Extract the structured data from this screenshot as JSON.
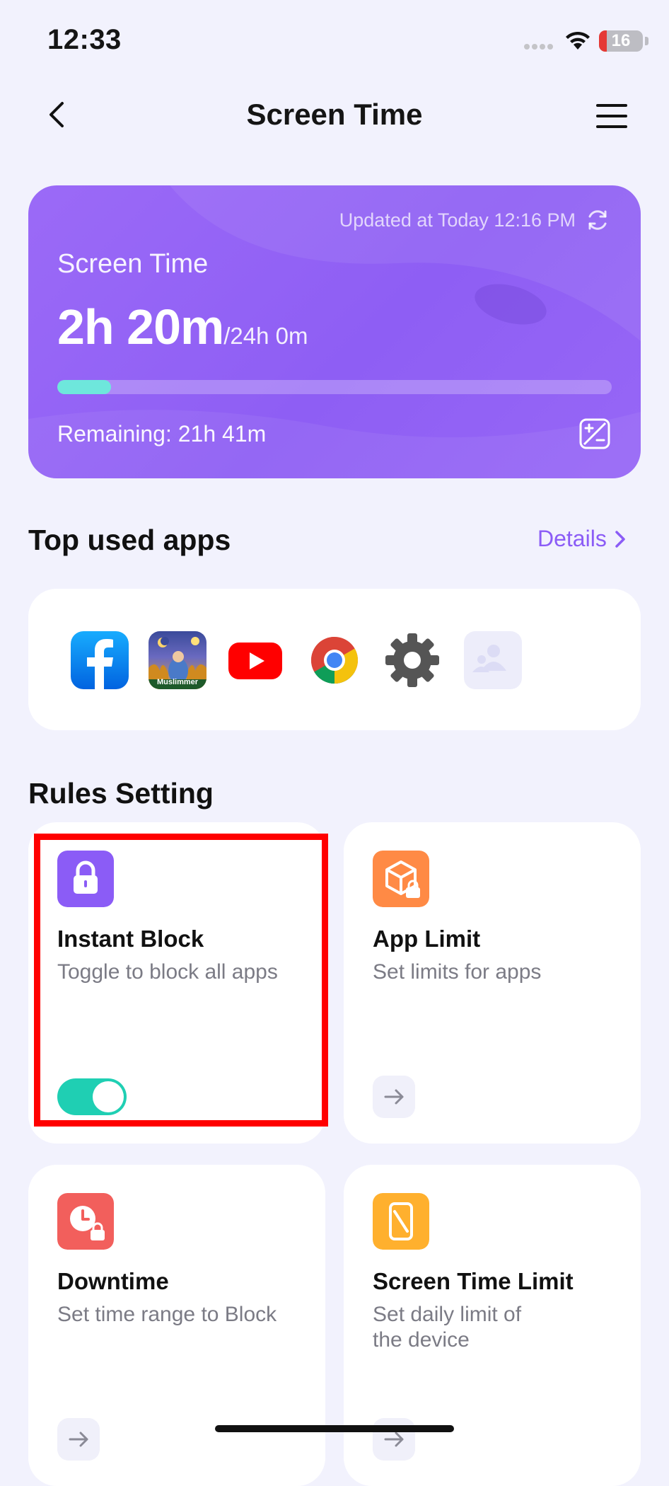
{
  "status_bar": {
    "time": "12:33",
    "battery": "16",
    "battery_level_percent": 16
  },
  "nav": {
    "title": "Screen Time",
    "back_icon": "chevron-left-icon",
    "menu_icon": "hamburger-menu-icon"
  },
  "screen_time_card": {
    "updated": "Updated at Today 12:16 PM",
    "label": "Screen Time",
    "used": "2h 20m",
    "total": "/24h 0m",
    "usage_fraction": 0.097,
    "remaining": "Remaining: 21h 41m",
    "colors": {
      "card": "#9364f5",
      "progress": "#6ee7dc"
    }
  },
  "top_apps": {
    "title": "Top used apps",
    "details_label": "Details",
    "apps": [
      {
        "name": "Facebook",
        "icon": "facebook-icon"
      },
      {
        "name": "Muslimmer",
        "icon": "muslimmer-icon"
      },
      {
        "name": "YouTube",
        "icon": "youtube-icon"
      },
      {
        "name": "Chrome",
        "icon": "chrome-icon"
      },
      {
        "name": "Settings",
        "icon": "settings-gear-icon"
      },
      {
        "name": "Family",
        "icon": "family-placeholder-icon"
      }
    ],
    "muslimmer_label": "Muslimmer"
  },
  "rules": {
    "title": "Rules Setting",
    "items": [
      {
        "title": "Instant Block",
        "desc": "Toggle to block all apps",
        "icon": "lock-icon",
        "color": "#8b5cf6",
        "toggle_on": true
      },
      {
        "title": "App Limit",
        "desc": "Set limits for apps",
        "icon": "app-limit-icon",
        "color": "#ff8a45"
      },
      {
        "title": "Downtime",
        "desc": "Set time range to Block",
        "icon": "downtime-clock-icon",
        "color": "#f25f5c"
      },
      {
        "title": "Screen Time Limit",
        "desc": "Set daily limit of the device",
        "icon": "phone-limit-icon",
        "color": "#ffb02e"
      }
    ]
  }
}
